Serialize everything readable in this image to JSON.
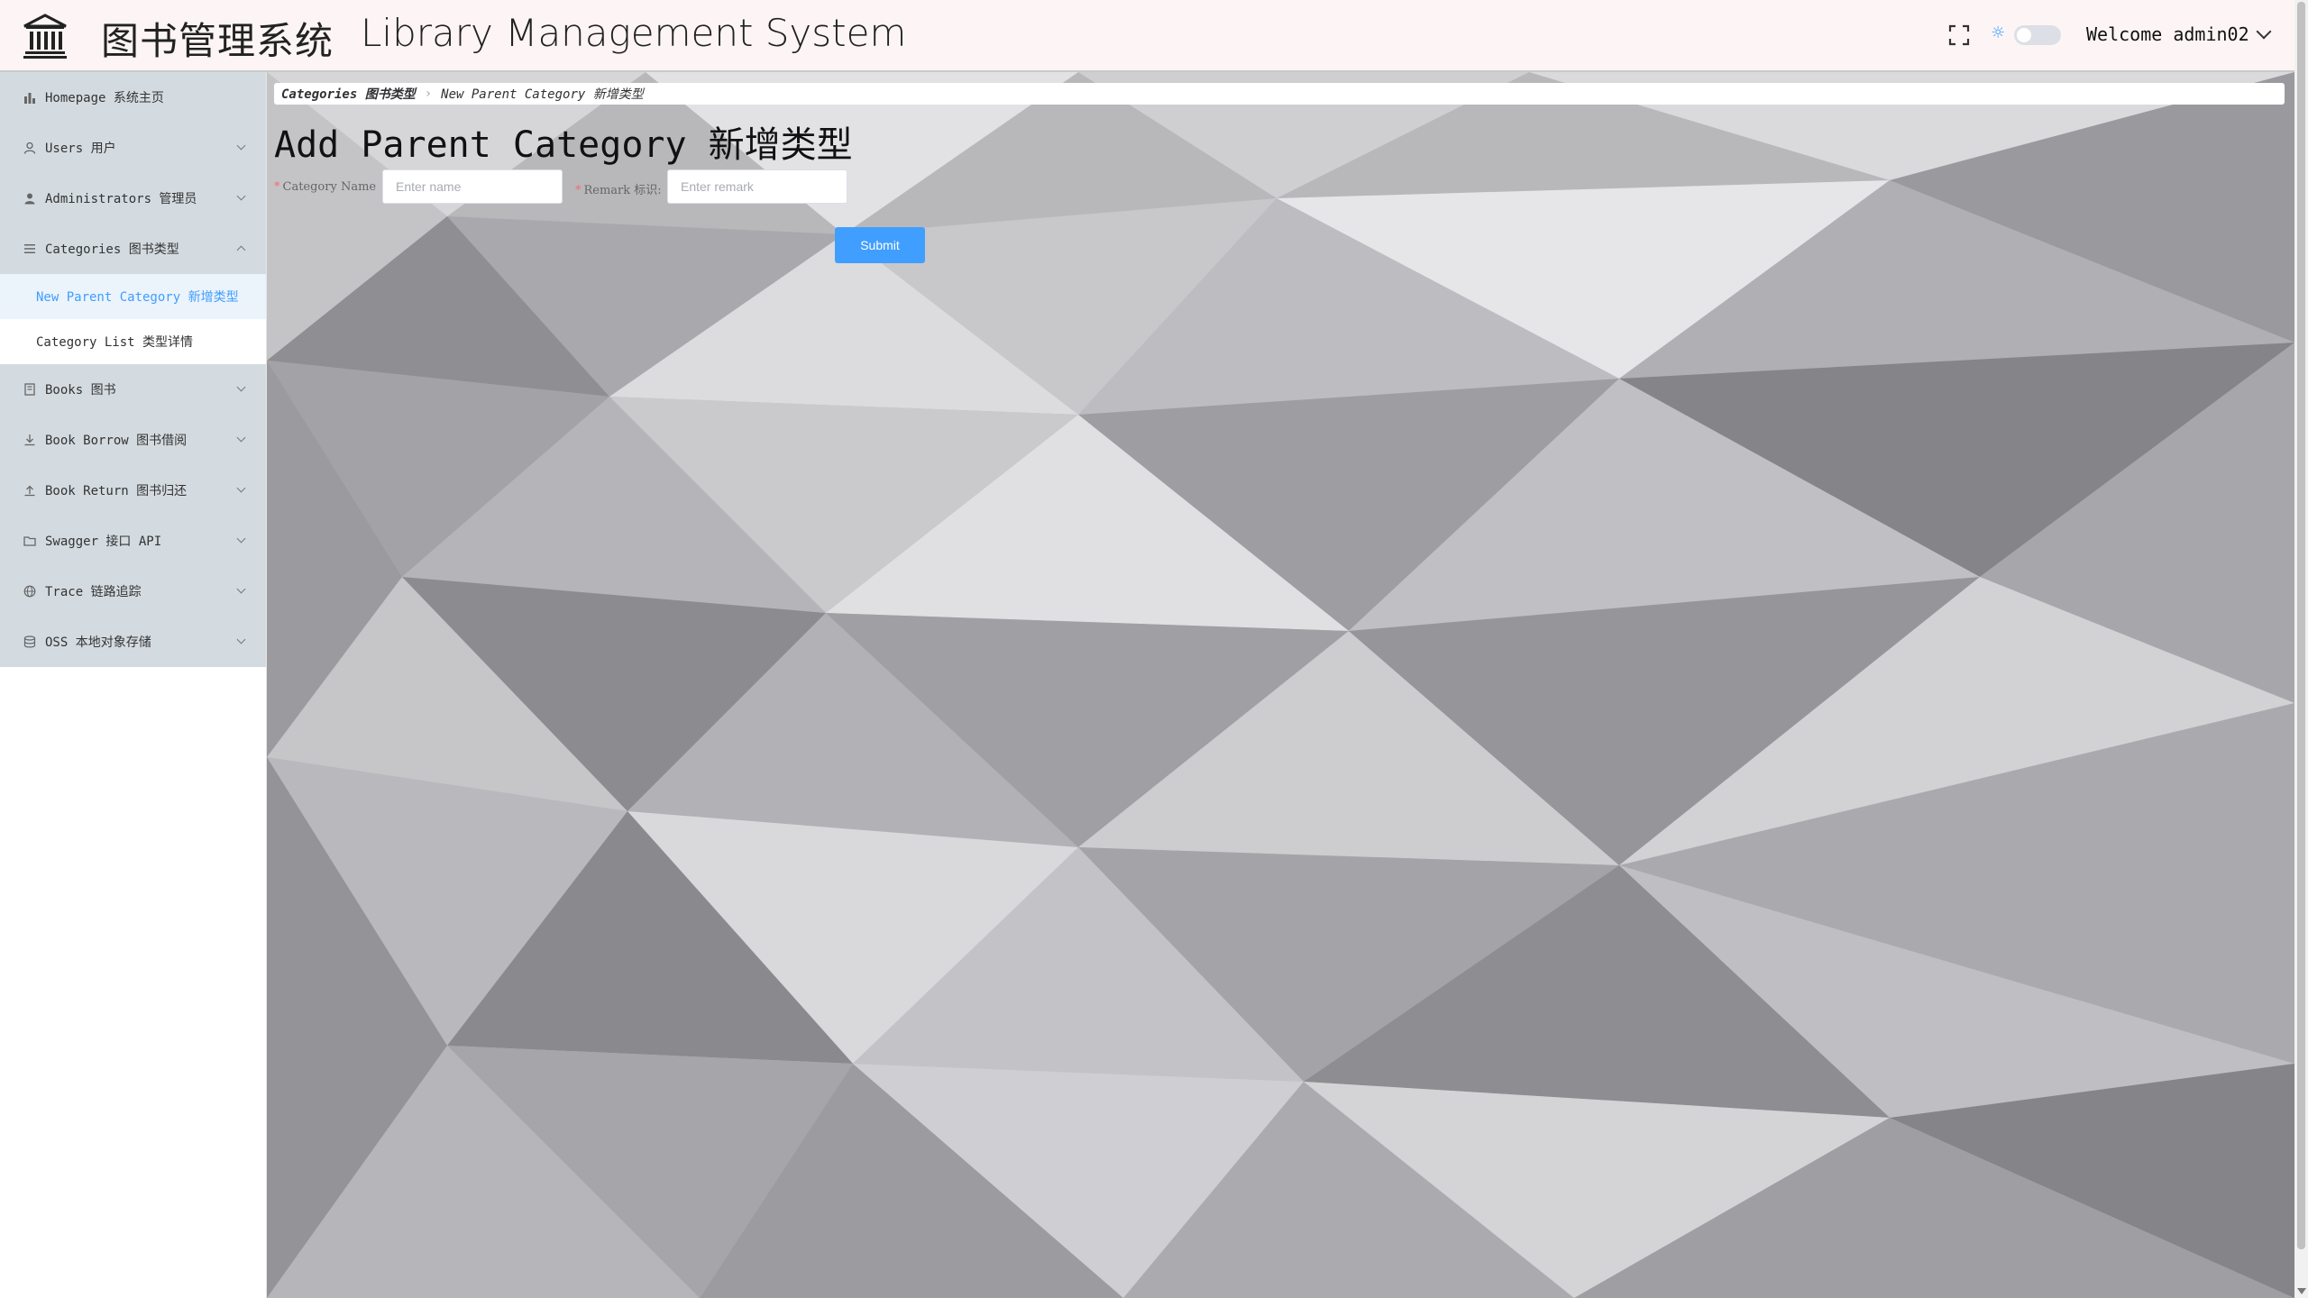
{
  "header": {
    "title_cn": "图书管理系统",
    "title_en": "Library Management System",
    "welcome": "Welcome admin02"
  },
  "sidebar": {
    "items": [
      {
        "label": "Homepage 系统主页",
        "icon": "bar-chart-icon",
        "expandable": false
      },
      {
        "label": "Users 用户",
        "icon": "user-icon",
        "expandable": true
      },
      {
        "label": "Administrators 管理员",
        "icon": "admin-icon",
        "expandable": true
      },
      {
        "label": "Categories 图书类型",
        "icon": "list-icon",
        "expandable": true,
        "expanded": true,
        "children": [
          {
            "label": "New Parent Category 新增类型",
            "active": true
          },
          {
            "label": "Category List 类型详情",
            "active": false
          }
        ]
      },
      {
        "label": "Books 图书",
        "icon": "book-icon",
        "expandable": true
      },
      {
        "label": "Book Borrow 图书借阅",
        "icon": "download-icon",
        "expandable": true
      },
      {
        "label": "Book Return 图书归还",
        "icon": "upload-icon",
        "expandable": true
      },
      {
        "label": "Swagger 接口 API",
        "icon": "folder-icon",
        "expandable": true
      },
      {
        "label": "Trace 链路追踪",
        "icon": "globe-icon",
        "expandable": true
      },
      {
        "label": "OSS 本地对象存储",
        "icon": "database-icon",
        "expandable": true
      }
    ]
  },
  "breadcrumb": {
    "parent": "Categories 图书类型",
    "current": "New Parent Category 新增类型"
  },
  "page": {
    "title": "Add Parent Category 新增类型"
  },
  "form": {
    "name_label": "Category Name",
    "name_placeholder": "Enter name",
    "remark_label": "Remark 标识",
    "remark_placeholder": "Enter remark",
    "submit_label": "Submit"
  },
  "theme": {
    "accent": "#409eff",
    "sidebar_bg": "#d4dbe0",
    "header_bg": "#fdf5f5"
  }
}
